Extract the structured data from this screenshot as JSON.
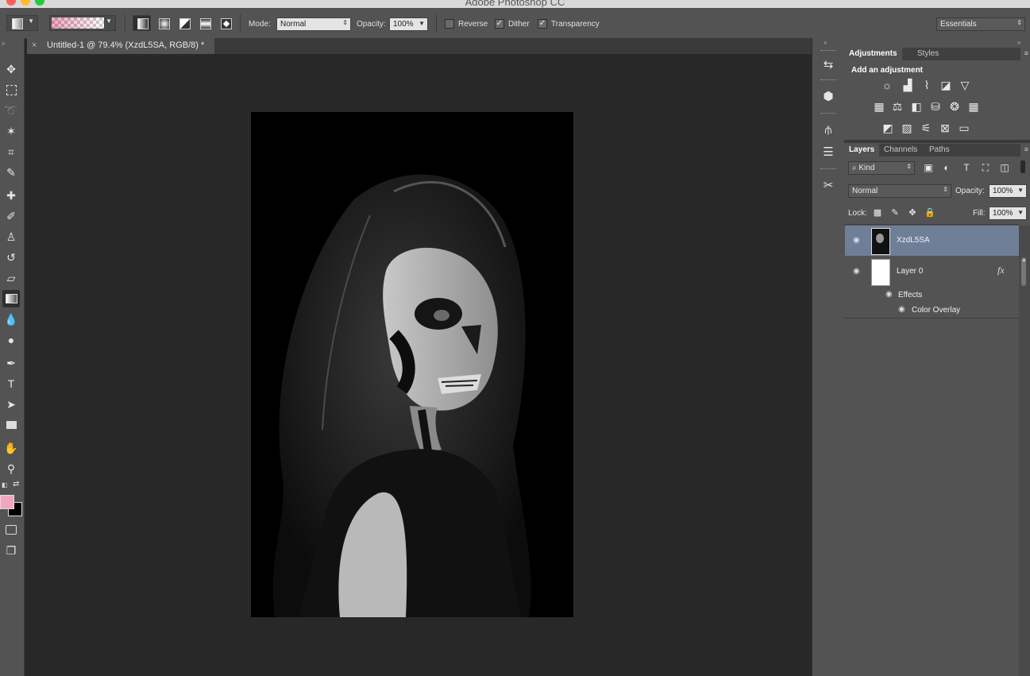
{
  "app": {
    "title": "Adobe Photoshop CC"
  },
  "options_bar": {
    "mode_label": "Mode:",
    "mode_value": "Normal",
    "opacity_label": "Opacity:",
    "opacity_value": "100%",
    "reverse_label": "Reverse",
    "reverse_checked": false,
    "dither_label": "Dither",
    "dither_checked": true,
    "transparency_label": "Transparency",
    "transparency_checked": true,
    "workspace": "Essentials",
    "gradient_colors": [
      "#f2a6bf",
      "#ffffff"
    ]
  },
  "document": {
    "tab_title": "Untitled-1 @ 79.4% (XzdL5SA, RGB/8) *",
    "close": "×"
  },
  "tools": [
    "move-tool",
    "marquee-tool",
    "lasso-tool",
    "magic-wand-tool",
    "crop-tool",
    "eyedropper-tool",
    "healing-brush-tool",
    "brush-tool",
    "clone-stamp-tool",
    "history-brush-tool",
    "eraser-tool",
    "gradient-tool",
    "blur-tool",
    "dodge-tool",
    "pen-tool",
    "type-tool",
    "path-selection-tool",
    "rectangle-tool",
    "hand-tool",
    "zoom-tool"
  ],
  "colors": {
    "foreground": "#f2a6bf",
    "background": "#000000",
    "selected_layer": "#6f7f98"
  },
  "adjustments_panel": {
    "tabs": [
      "Adjustments",
      "Styles"
    ],
    "heading": "Add an adjustment"
  },
  "layers_panel": {
    "tabs": [
      "Layers",
      "Channels",
      "Paths"
    ],
    "filter_kind": "Kind",
    "blend_mode": "Normal",
    "opacity_label": "Opacity:",
    "opacity_value": "100%",
    "lock_label": "Lock:",
    "fill_label": "Fill:",
    "fill_value": "100%",
    "layers": [
      {
        "name": "XzdL5SA",
        "selected": true
      },
      {
        "name": "Layer 0",
        "selected": false,
        "fx": "fx"
      }
    ],
    "effects_label": "Effects",
    "effect_items": [
      "Color Overlay"
    ]
  }
}
